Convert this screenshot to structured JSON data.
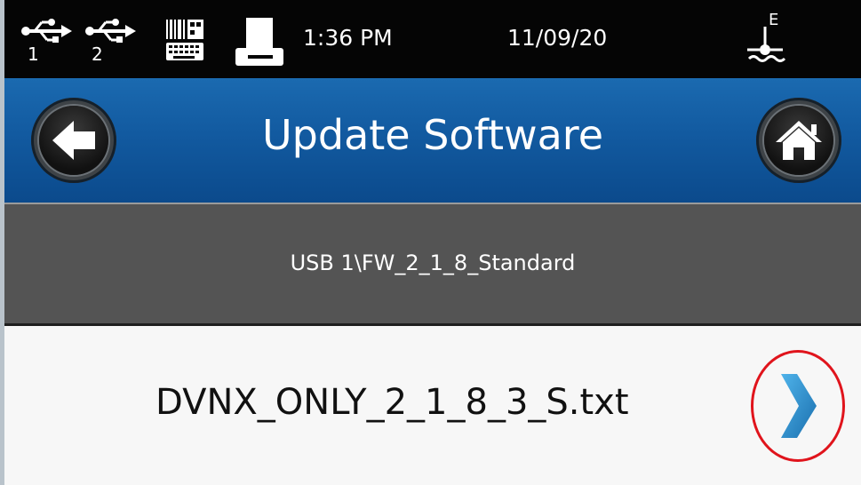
{
  "status_bar": {
    "usb1_icon": "usb-icon",
    "usb1_number": "1",
    "usb2_icon": "usb-icon",
    "usb2_number": "2",
    "scanner_icon": "barcode-keyboard-icon",
    "printer_icon": "printer-icon",
    "time": "1:36 PM",
    "date": "11/09/20",
    "level_icon": "ink-level-icon",
    "level_label": "E"
  },
  "title_bar": {
    "title": "Update Software",
    "back_icon": "back-arrow-icon",
    "home_icon": "home-icon"
  },
  "path_bar": {
    "path": "USB 1\\FW_2_1_8_Standard"
  },
  "file_list": {
    "items": [
      {
        "name": "DVNX_ONLY_2_1_8_3_S.txt",
        "chevron_icon": "chevron-right-icon"
      }
    ]
  },
  "colors": {
    "status_bar_bg": "#050505",
    "title_bar_bg": "#125aa0",
    "path_bar_bg": "#545454",
    "row_bg": "#f7f7f7",
    "chevron": "#2a8fd0",
    "highlight_circle": "#e0141c"
  }
}
